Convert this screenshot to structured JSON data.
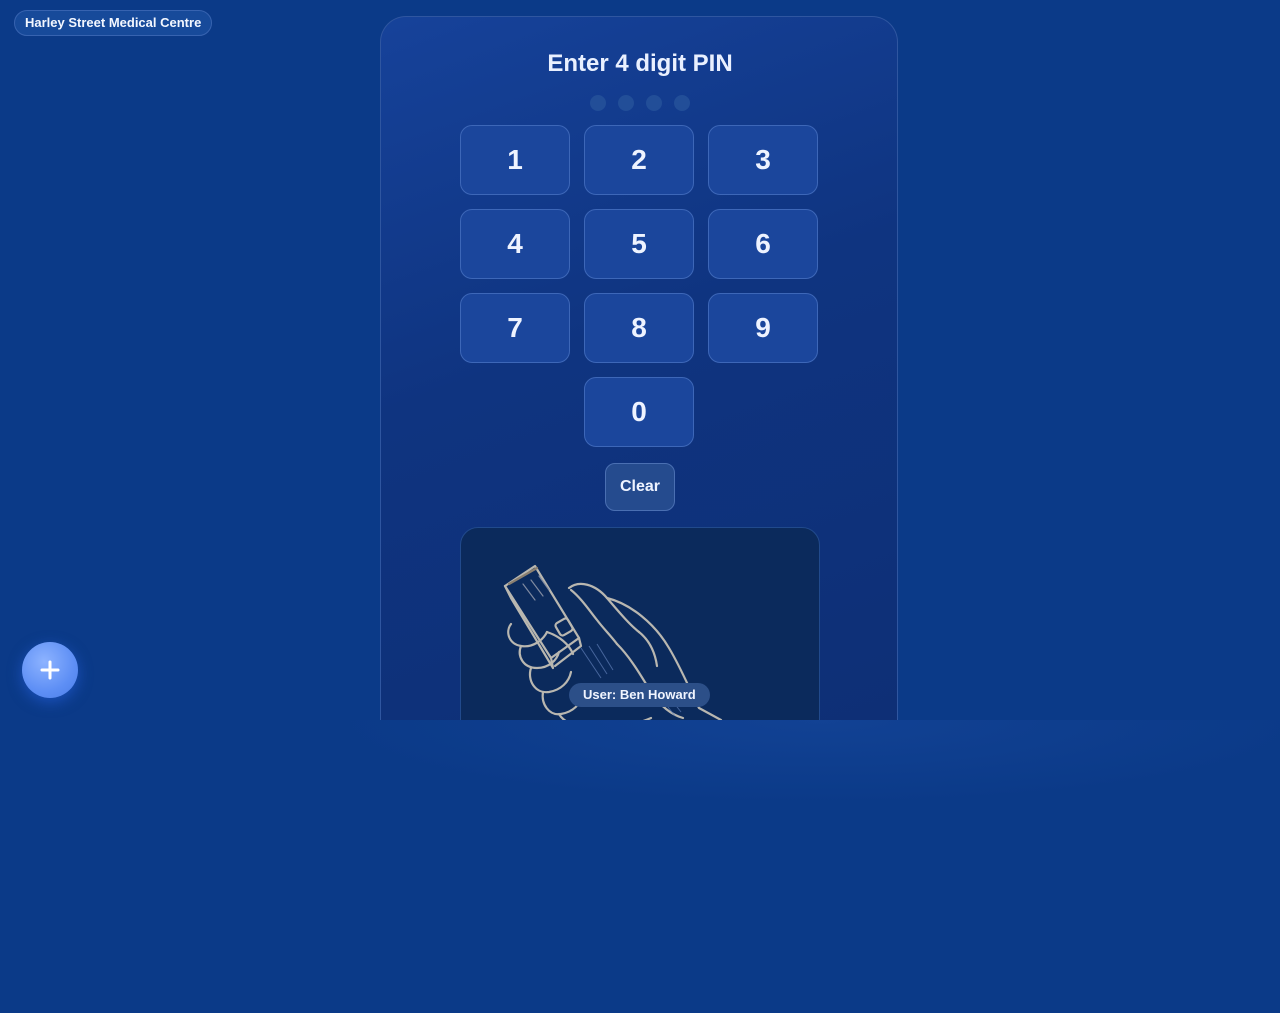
{
  "clinic": {
    "name": "Harley Street Medical Centre"
  },
  "pin": {
    "title": "Enter 4 digit PIN",
    "dots_filled": 0,
    "dots_total": 4,
    "keys": [
      "1",
      "2",
      "3",
      "4",
      "5",
      "6",
      "7",
      "8",
      "9",
      "0"
    ],
    "clear_label": "Clear"
  },
  "scanner": {
    "image": "hand-holding-phone-sketch",
    "user_label": "User: Ben Howard"
  },
  "fab": {
    "icon": "plus-icon"
  },
  "colors": {
    "background": "#0b3a88",
    "panel": "#0f3480",
    "key": "#1b469c",
    "fab": "#5e8ff5"
  }
}
